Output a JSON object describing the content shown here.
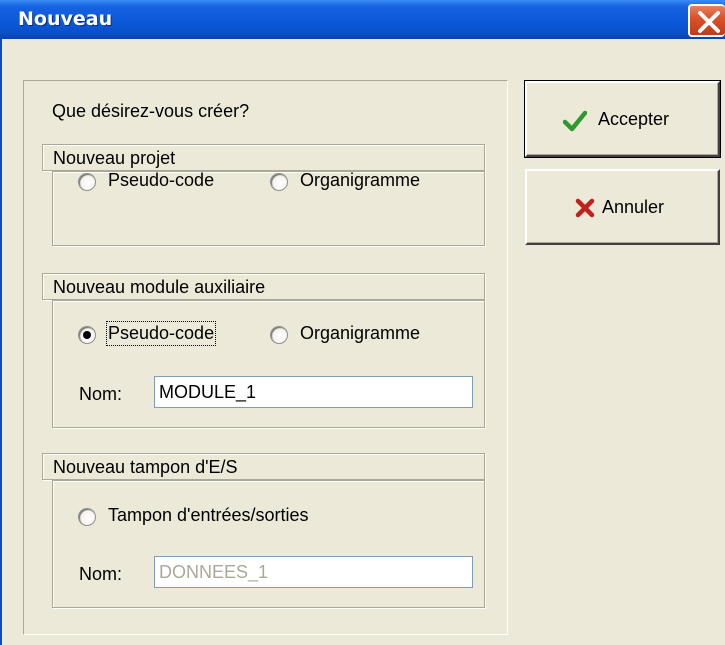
{
  "window": {
    "title": "Nouveau"
  },
  "prompt": "Que désirez-vous créer?",
  "groups": {
    "projet": {
      "title": "Nouveau projet",
      "options": [
        "Pseudo-code",
        "Organigramme"
      ],
      "selected": null
    },
    "module": {
      "title": "Nouveau module auxiliaire",
      "options": [
        "Pseudo-code",
        "Organigramme"
      ],
      "selected": "Pseudo-code",
      "name_label": "Nom:",
      "name_value": "MODULE_1"
    },
    "tampon": {
      "title": "Nouveau tampon d'E/S",
      "option": "Tampon d'entrées/sorties",
      "selected": false,
      "name_label": "Nom:",
      "name_value": "DONNEES_1",
      "disabled": true
    }
  },
  "buttons": {
    "accept": {
      "label": "Accepter",
      "icon": "checkmark-icon",
      "color": "#2E9A2E"
    },
    "cancel": {
      "label": "Annuler",
      "icon": "cross-icon",
      "color": "#C0211B"
    }
  },
  "colors": {
    "titlebar": "#0A58D8",
    "dialog_bg": "#ECE9D8",
    "close_button": "#D9532D"
  }
}
